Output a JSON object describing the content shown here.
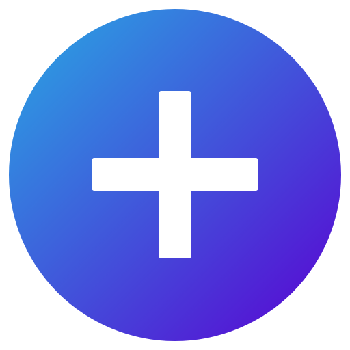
{
  "add_button": {
    "icon": "plus-icon",
    "colors": {
      "gradient_start": "#28AAE3",
      "gradient_end": "#5A00D2",
      "glyph": "#FFFFFF"
    }
  }
}
